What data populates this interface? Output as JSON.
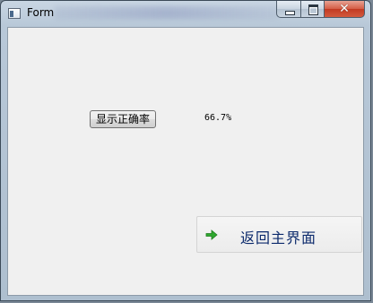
{
  "window": {
    "title": "Form",
    "icons": {
      "app": "app-window-icon",
      "minimize": "minimize-icon",
      "maximize": "maximize-icon",
      "close": "close-icon"
    }
  },
  "main": {
    "show_accuracy_button": "显示正确率",
    "accuracy_value": "66.7%",
    "return_button": {
      "label": "返回主界面",
      "icon": "arrow-right-icon",
      "icon_color": "#2ea82e"
    }
  },
  "colors": {
    "client_background": "#f0f0f0",
    "return_label": "#0c2a6c",
    "close_button": "#c94a32"
  }
}
